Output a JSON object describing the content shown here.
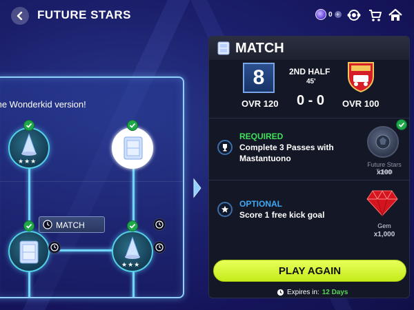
{
  "header": {
    "title": "FUTURE STARS",
    "currency_count": "0"
  },
  "board": {
    "message": "the Wonderkid version!",
    "match_pill": "MATCH",
    "node_stars": "★★★"
  },
  "panel": {
    "title": "MATCH",
    "user_ovr_value": "8",
    "user_ovr": "OVR 120",
    "half": "2ND HALF",
    "minute": "45'",
    "score": "0 - 0",
    "opponent_ovr": "OVR 100",
    "required": {
      "kind": "REQUIRED",
      "text_line1": "Complete 3 Passes with",
      "text_line2": "Mastantuono",
      "reward_name": "Future Stars Token",
      "reward_qty": "x100"
    },
    "optional": {
      "kind": "OPTIONAL",
      "text": "Score 1 free kick goal",
      "reward_name": "Gem",
      "reward_qty": "x1,000"
    },
    "play_again": "PLAY AGAIN",
    "expires_label": "Expires in:",
    "expires_value": "12 Days"
  },
  "colors": {
    "required": "#40e05a",
    "optional": "#3fa9f5",
    "play_button": "#d6f52e",
    "expires_value": "#57d657"
  },
  "icons": [
    "back-arrow-icon",
    "coin-icon",
    "plus-icon",
    "friends-icon",
    "shop-cart-icon",
    "home-icon",
    "check-icon",
    "clock-icon",
    "trophy-icon",
    "star-icon",
    "gem-icon",
    "token-icon"
  ]
}
